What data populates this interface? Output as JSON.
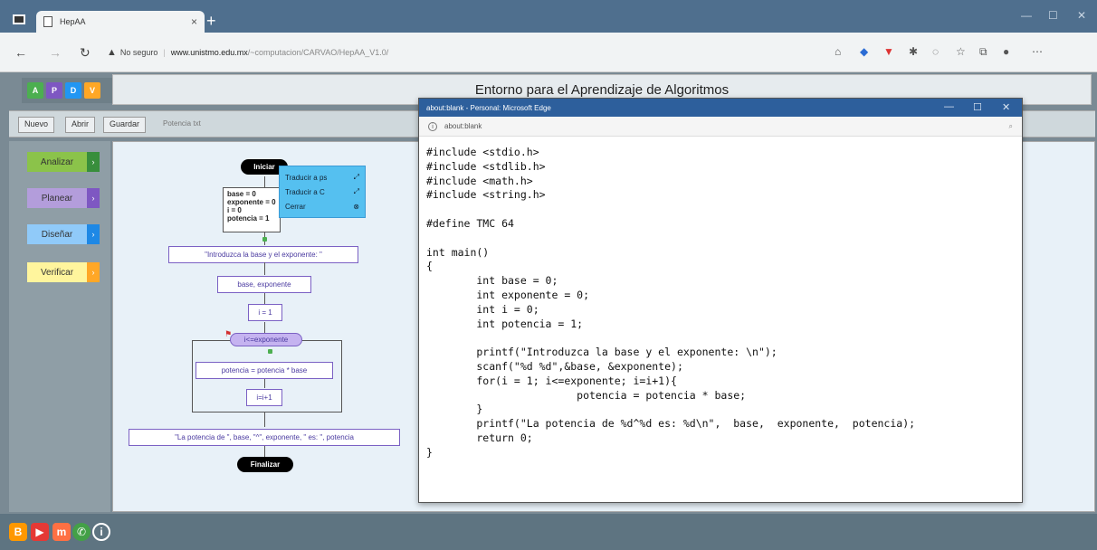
{
  "browser": {
    "tab_title": "HepAA",
    "url_warning": "No seguro",
    "url_domain": "www.unistmo.edu.mx",
    "url_path": "/~computacion/CARVAO/HepAA_V1.0/"
  },
  "app": {
    "title": "Entorno para el Aprendizaje de Algoritmos",
    "toolbar": {
      "new": "Nuevo",
      "open": "Abrir",
      "save": "Guardar",
      "filename": "Potencia txt"
    },
    "sidebar": [
      {
        "label": "Analizar",
        "color": "#8bc34a",
        "arrow_color": "#4caf50"
      },
      {
        "label": "Planear",
        "color": "#b39ddb",
        "arrow_color": "#7e57c2"
      },
      {
        "label": "Diseñar",
        "color": "#90caf9",
        "arrow_color": "#2196f3"
      },
      {
        "label": "Verificar",
        "color": "#fff59d",
        "arrow_color": "#ffa726"
      }
    ]
  },
  "flowchart": {
    "start": "Iniciar",
    "init_lines": [
      "base = 0",
      "exponente = 0",
      "i = 0",
      "potencia = 1"
    ],
    "output1": "\"Introduzca la base y el exponente: \"",
    "input1": "base, exponente",
    "assign_i": "i = 1",
    "condition": "i<=exponente",
    "loop_body": "potencia = potencia * base",
    "increment": "i=i+1",
    "output2": "\"La potencia de \", base, \"^\", exponente, \" es: \", potencia",
    "end": "Finalizar"
  },
  "context_menu": {
    "items": [
      "Traducir a ps",
      "Traducir a C",
      "Cerrar"
    ]
  },
  "popup": {
    "title": "about:blank - Personal: Microsoft Edge",
    "address": "about:blank",
    "code": "#include <stdio.h>\n#include <stdlib.h>\n#include <math.h>\n#include <string.h>\n\n#define TMC 64\n\nint main()\n{\n        int base = 0;\n        int exponente = 0;\n        int i = 0;\n        int potencia = 1;\n\n        printf(\"Introduzca la base y el exponente: \\n\");\n        scanf(\"%d %d\",&base, &exponente);\n        for(i = 1; i<=exponente; i=i+1){\n                        potencia = potencia * base;\n        }\n        printf(\"La potencia de %d^%d es: %d\\n\",  base,  exponente,  potencia);\n        return 0;\n}"
  }
}
